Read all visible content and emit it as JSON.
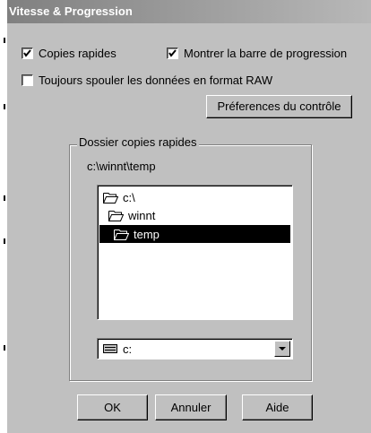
{
  "dialog": {
    "title": "Vitesse & Progression"
  },
  "options": {
    "fast_copies": {
      "label": "Copies rapides",
      "checked": true
    },
    "progress_bar": {
      "label": "Montrer la barre de progression",
      "checked": true
    },
    "raw_spool": {
      "label": "Toujours spouler les données en format RAW",
      "checked": false
    }
  },
  "monitor_prefs_button": {
    "label": "Préferences du contrôle"
  },
  "fast_copy_folder": {
    "group_label": "Dossier copies rapides",
    "current_path": "c:\\winnt\\temp",
    "directories": [
      {
        "label": "c:\\",
        "state": "open"
      },
      {
        "label": "winnt",
        "state": "open"
      },
      {
        "label": "temp",
        "state": "open-selected"
      }
    ],
    "drive": {
      "label": "c:",
      "icon": "drive-icon"
    }
  },
  "buttons": {
    "ok": "OK",
    "cancel": "Annuler",
    "help": "Aide"
  },
  "colors": {
    "face": "#c0c0c0",
    "selection": "#000000",
    "title_start": "#808080",
    "title_end": "#b8b8b8"
  }
}
